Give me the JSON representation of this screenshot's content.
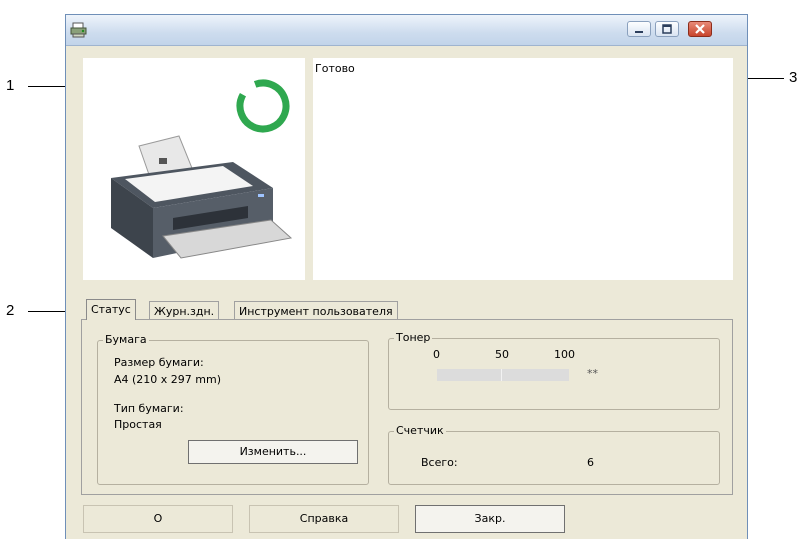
{
  "callouts": {
    "one": "1",
    "two": "2",
    "three": "3"
  },
  "window": {
    "title": "",
    "controls": {
      "minimize": "minimize-icon",
      "maximize": "maximize-icon",
      "close": "close-icon"
    }
  },
  "status_message": "Готово",
  "status_indicator_color": "#2fa84f",
  "tabs": [
    {
      "label": "Статус"
    },
    {
      "label": "Журн.здн."
    },
    {
      "label": "Инструмент пользователя"
    }
  ],
  "paper": {
    "legend": "Бумага",
    "size_label": "Размер бумаги:",
    "size_value": "A4 (210 x 297 mm)",
    "type_label": "Тип бумаги:",
    "type_value": "Простая",
    "change_button": "Изменить..."
  },
  "toner": {
    "legend": "Тонер",
    "scale_0": "0",
    "scale_50": "50",
    "scale_100": "100",
    "value_text": "**"
  },
  "counter": {
    "legend": "Счетчик",
    "total_label": "Всего:",
    "total_value": "6"
  },
  "buttons": {
    "about": "О",
    "help": "Справка",
    "close": "Закр."
  }
}
